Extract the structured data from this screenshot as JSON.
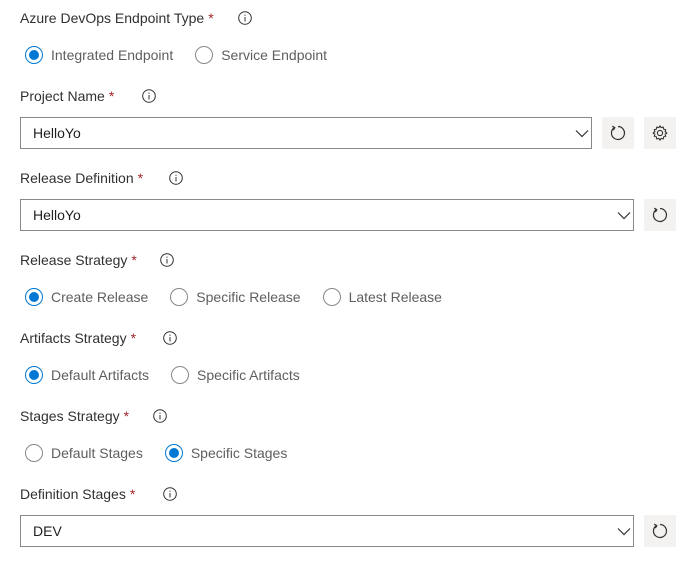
{
  "endpoint_type": {
    "label": "Azure DevOps Endpoint Type",
    "required_mark": "*",
    "options": [
      "Integrated Endpoint",
      "Service Endpoint"
    ]
  },
  "project_name": {
    "label": "Project Name",
    "required_mark": "*",
    "value": "HelloYo"
  },
  "release_definition": {
    "label": "Release Definition",
    "required_mark": "*",
    "value": "HelloYo"
  },
  "release_strategy": {
    "label": "Release Strategy",
    "required_mark": "*",
    "options": [
      "Create Release",
      "Specific Release",
      "Latest Release"
    ]
  },
  "artifacts_strategy": {
    "label": "Artifacts Strategy",
    "required_mark": "*",
    "options": [
      "Default Artifacts",
      "Specific Artifacts"
    ]
  },
  "stages_strategy": {
    "label": "Stages Strategy",
    "required_mark": "*",
    "options": [
      "Default Stages",
      "Specific Stages"
    ]
  },
  "definition_stages": {
    "label": "Definition Stages",
    "required_mark": "*",
    "value": "DEV"
  },
  "colors": {
    "accent": "#0078d4",
    "required": "#a4262c",
    "border": "#8a8886",
    "button_bg": "#f3f2f1"
  },
  "icons": {
    "info": "info-icon",
    "chevron": "chevron-down-icon",
    "refresh": "refresh-icon",
    "settings": "gear-icon"
  }
}
